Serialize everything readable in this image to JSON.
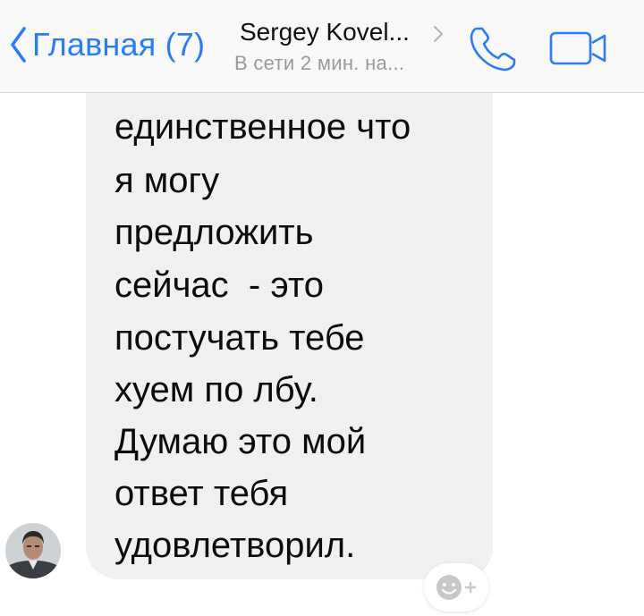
{
  "header": {
    "back_label": "Главная (7)",
    "contact_name": "Sergey Kovel...",
    "status": "В сети 2 мин. на..."
  },
  "message": {
    "lines": [
      "единственное что",
      "я могу",
      "предложить",
      "сейчас  - это",
      "постучать тебе",
      "хуем по лбу.",
      "Думаю это мой",
      "ответ тебя",
      "удовлетворил."
    ]
  },
  "icons": {
    "back": "chevron-left-icon",
    "title": "chevron-right-icon",
    "call": "phone-icon",
    "video": "video-camera-icon",
    "reaction": "emoji-add-icon"
  },
  "colors": {
    "accent": "#2a7cf6",
    "bubble": "#f1f0f0",
    "status_text": "#9a9a9a",
    "nav_background": "#f8f8f8"
  }
}
